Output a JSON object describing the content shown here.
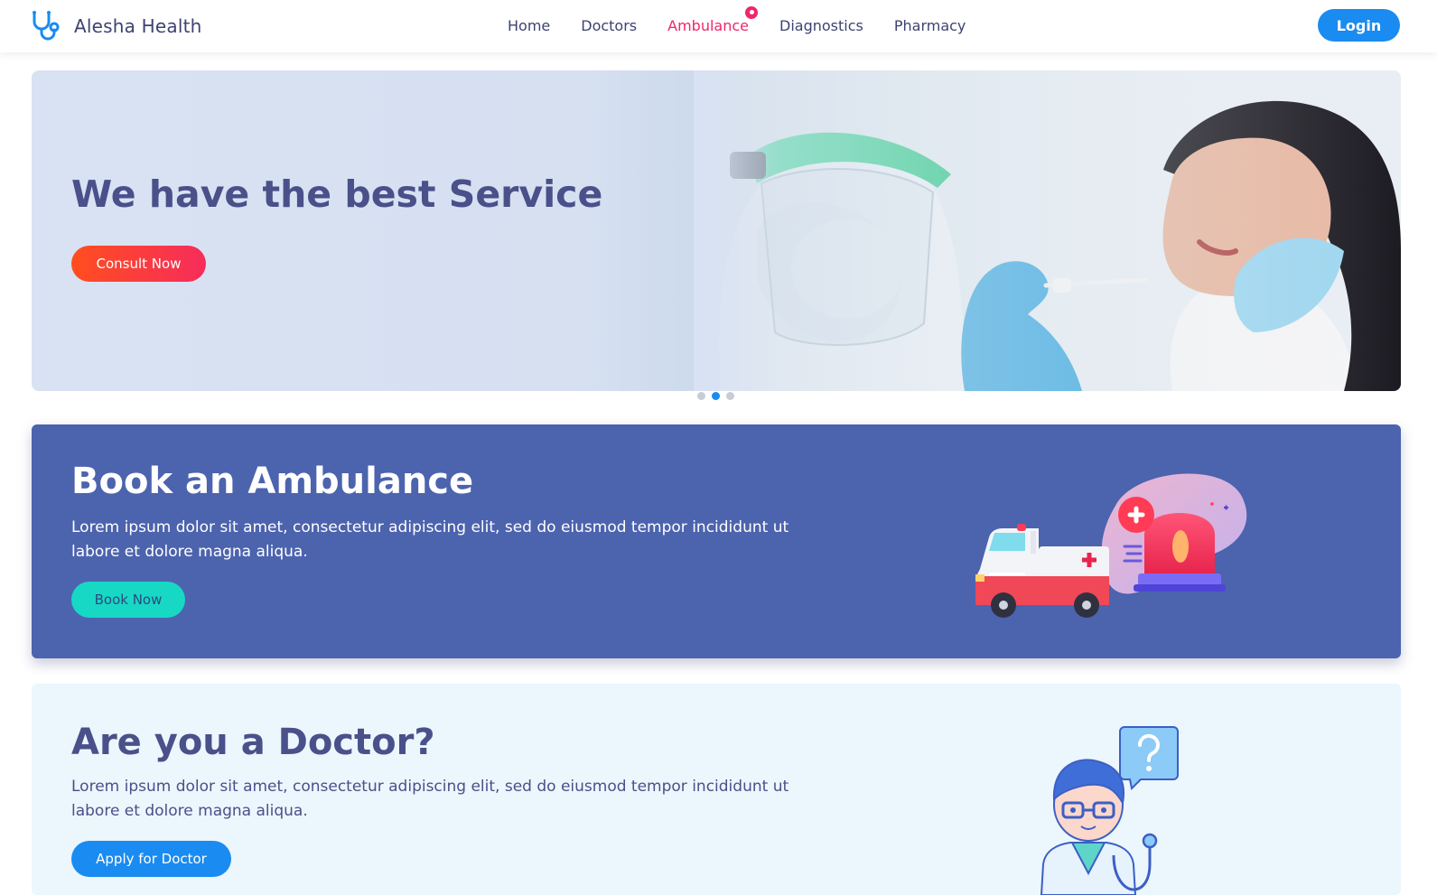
{
  "brand": {
    "name": "Alesha Health",
    "icon": "stethoscope-icon",
    "color": "#1a8bf0"
  },
  "nav": {
    "items": [
      {
        "label": "Home",
        "active": false
      },
      {
        "label": "Doctors",
        "active": false
      },
      {
        "label": "Ambulance",
        "active": true,
        "badge": "notification-dot"
      },
      {
        "label": "Diagnostics",
        "active": false
      },
      {
        "label": "Pharmacy",
        "active": false
      }
    ],
    "active_color": "#f0266b",
    "login_label": "Login"
  },
  "hero": {
    "title": "We have the best Service",
    "cta_label": "Consult Now",
    "slides_count": 3,
    "active_slide": 2
  },
  "ambulance": {
    "title": "Book an Ambulance",
    "description": "Lorem ipsum dolor sit amet, consectetur adipiscing elit, sed do eiusmod tempor incididunt ut labore et dolore magna aliqua.",
    "cta_label": "Book Now",
    "background": "#4c63ae",
    "cta_color": "#17d8c4"
  },
  "doctor": {
    "title": "Are you a Doctor?",
    "description": "Lorem ipsum dolor sit amet, consectetur adipiscing elit, sed do eiusmod tempor incididunt ut labore et dolore magna aliqua.",
    "cta_label": "Apply for Doctor",
    "background": "#ecf6fd",
    "cta_color": "#1a8bf0"
  }
}
